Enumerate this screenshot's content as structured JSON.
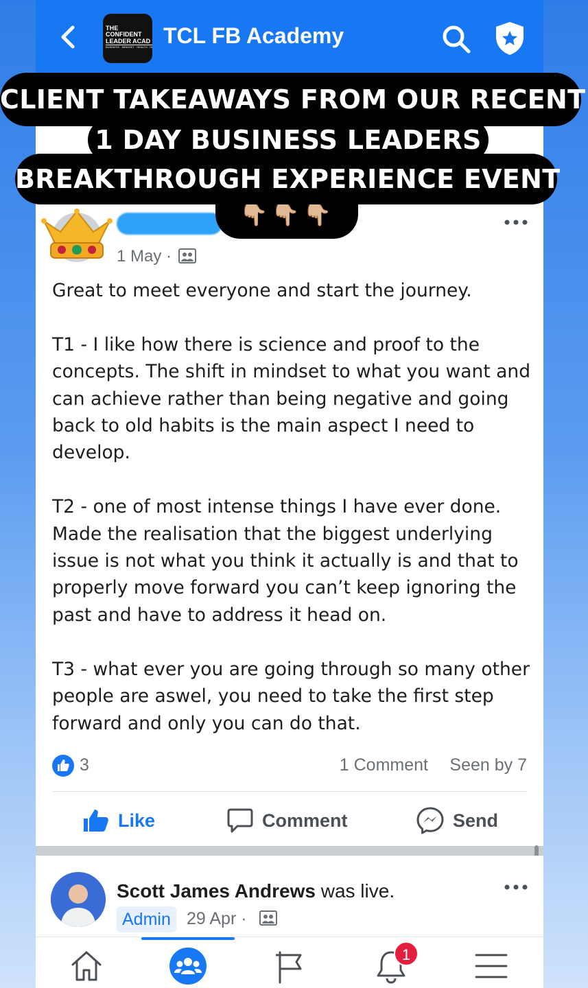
{
  "header": {
    "group_name": "TCL FB Academy",
    "logo": {
      "line1": "THE",
      "line2": "CONFIDENT",
      "line3": "LEADER ACAD",
      "line4": "BUSINESS · MINDSET · HEALTH · RE"
    }
  },
  "overlay": {
    "line1": "CLIENT TAKEAWAYS FROM OUR RECENT",
    "line2": "1 DAY BUSINESS LEADERS",
    "line3": "BREAKTHROUGH EXPERIENCE EVENT",
    "emoji": "👇🏼👇🏼👇🏼"
  },
  "post": {
    "date": "1 May ·",
    "body": "Great to meet everyone and start the journey.\n\nT1 - I like how there is science and proof to the concepts. The shift in mindset to what you want and can achieve rather than being negative and going back to old habits is the main aspect I need to develop.\n\nT2 - one of most intense things I have ever done. Made the realisation that the biggest underlying issue is not what you think it actually is and that to properly move forward you can’t keep ignoring the past and have to address it head on.\n\nT3 - what ever you are going through so many other people are aswel, you need to take the first step forward and only you can do that.",
    "like_count": "3",
    "comments": "1 Comment",
    "seen_by": "Seen by 7",
    "actions": {
      "like": "Like",
      "comment": "Comment",
      "send": "Send"
    }
  },
  "next_post": {
    "author": "Scott James Andrews",
    "action": " was live.",
    "badge": "Admin",
    "date": "29 Apr ·"
  },
  "notifications": {
    "count": "1"
  },
  "colors": {
    "brand": "#1877f2",
    "badge": "#e41e3f"
  }
}
